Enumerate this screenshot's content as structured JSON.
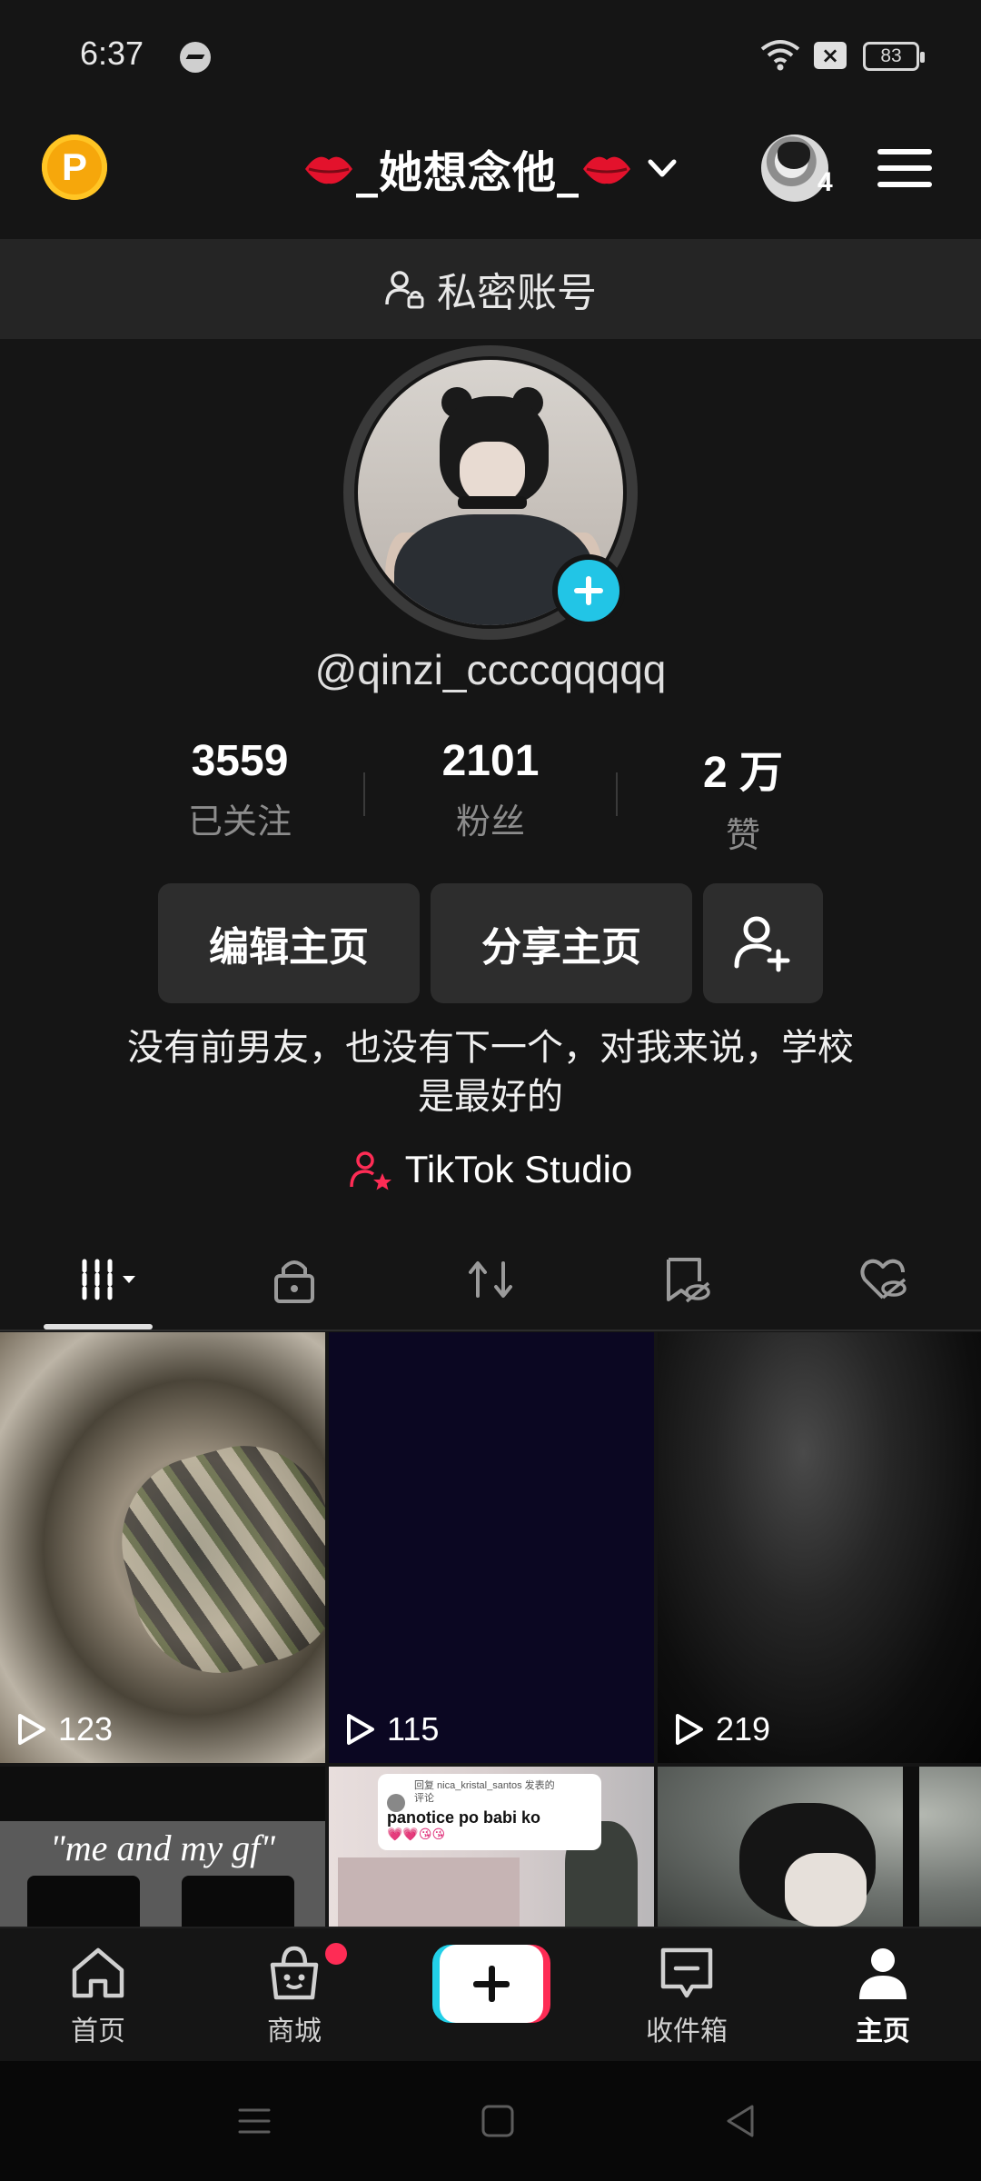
{
  "status_bar": {
    "time": "6:37",
    "battery": "83",
    "icons": [
      "messenger-icon",
      "wifi-icon",
      "notification-x-icon",
      "battery-icon"
    ]
  },
  "top_nav": {
    "coin_label": "P",
    "account_name": "_她想念他_",
    "avatar_count": "4"
  },
  "private_banner": {
    "label": "私密账号"
  },
  "profile": {
    "handle": "@qinzi_ccccqqqqq",
    "stats": [
      {
        "value": "3559",
        "label": "已关注"
      },
      {
        "value": "2101",
        "label": "粉丝"
      },
      {
        "value": "2 万",
        "label": "赞"
      }
    ],
    "buttons": {
      "edit": "编辑主页",
      "share": "分享主页"
    },
    "bio_line1": "没有前男友，也没有下一个，对我来说，学校",
    "bio_line2": "是最好的",
    "studio_label": "TikTok Studio"
  },
  "tabs": [
    {
      "name": "videos",
      "icon": "grid-icon",
      "active": true
    },
    {
      "name": "private",
      "icon": "lock-icon"
    },
    {
      "name": "reposts",
      "icon": "repost-icon"
    },
    {
      "name": "favorites",
      "icon": "bookmark-hidden-icon"
    },
    {
      "name": "liked",
      "icon": "heart-hidden-icon"
    }
  ],
  "grid": {
    "videos": [
      {
        "plays": "123"
      },
      {
        "plays": "115"
      },
      {
        "plays": "219"
      }
    ],
    "caption_text": "\"me and my gf\"",
    "comment_header": "回复 nica_kristal_santos 发表的",
    "comment_header2": "评论",
    "comment_text": "panotice po babi ko",
    "comment_emoji": "💗💗😘😘"
  },
  "bottom_nav": {
    "items": [
      {
        "label": "首页",
        "icon": "home-icon"
      },
      {
        "label": "商城",
        "icon": "shop-icon"
      },
      {
        "label": "",
        "icon": "create-icon"
      },
      {
        "label": "收件箱",
        "icon": "inbox-icon"
      },
      {
        "label": "主页",
        "icon": "profile-icon",
        "active": true
      }
    ]
  },
  "colors": {
    "background": "#151515",
    "accent_cyan": "#22c5e6",
    "accent_red": "#fe2c55",
    "coin": "#f6a70b"
  }
}
